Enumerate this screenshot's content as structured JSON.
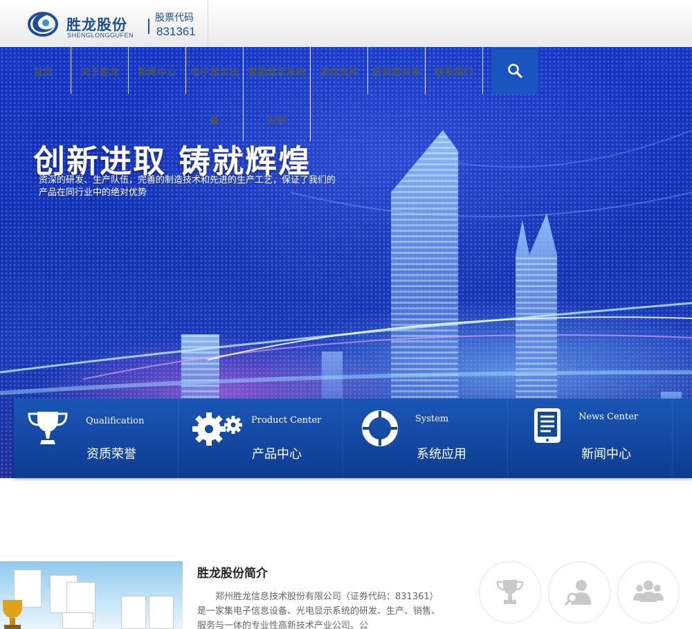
{
  "header": {
    "logo_cn": "胜龙股份",
    "logo_en": "SHENGLONGGUFEN",
    "stock_label": "股票代码",
    "stock_code": "831361",
    "brand_color": "#1d4f99"
  },
  "nav": {
    "items": [
      {
        "line1": "首页",
        "line2": ""
      },
      {
        "line1": "关于胜龙",
        "line2": ""
      },
      {
        "line1": "新闻中心",
        "line2": ""
      },
      {
        "line1": "电子显示设",
        "line2": "备"
      },
      {
        "line1": "智能显示系统",
        "line2": "应用"
      },
      {
        "line1": "服务支持",
        "line2": ""
      },
      {
        "line1": "投资者关系",
        "line2": ""
      },
      {
        "line1": "联系我们",
        "line2": ""
      }
    ],
    "search_icon": "search-icon",
    "search_color": "#1a54bf"
  },
  "banner": {
    "slogan": "创新进取  铸就辉煌",
    "subtitle": "资深的研发、生产队伍，完善的制造技术和先进的生产工艺，保证了我们的产品在同行业中的绝对优势",
    "slides": [
      {
        "active": false
      },
      {
        "active": false
      },
      {
        "active": true
      },
      {
        "active": false
      }
    ]
  },
  "quick_links": [
    {
      "en": "Qualification",
      "cn": "资质荣誉",
      "icon": "trophy-icon"
    },
    {
      "en": "Product Center",
      "cn": "产品中心",
      "icon": "gears-icon"
    },
    {
      "en": "System",
      "cn": "系统应用",
      "icon": "lifebuoy-icon"
    },
    {
      "en": "News Center",
      "cn": "新闻中心",
      "icon": "tablet-document-icon"
    }
  ],
  "intro": {
    "title": "胜龙股份简介",
    "text": "郑州胜龙信息技术股份有限公司（证券代码：831361）是一家集电子信息设备、光电显示系统的研发、生产、销售、服务与一体的专业性高新技术产业公司。公",
    "circle_icons": [
      "trophy-icon",
      "user-search-icon",
      "users-icon"
    ]
  }
}
